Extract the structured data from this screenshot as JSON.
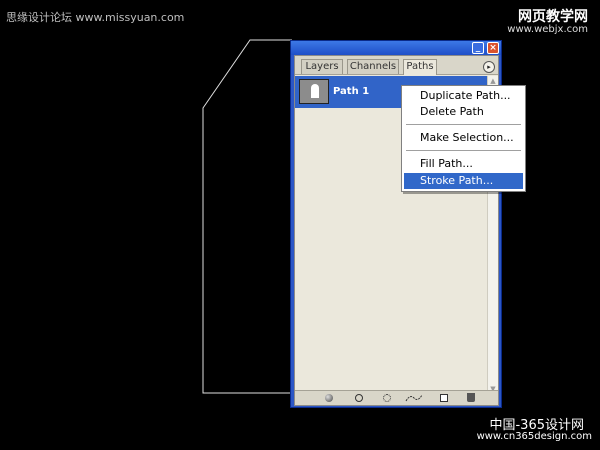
{
  "watermarks": {
    "top_left": "思缘设计论坛 www.missyuan.com",
    "top_right_main": "网页教学网",
    "top_right_url": "www.webjx.com",
    "bottom_right_main": "中国-365设计网",
    "bottom_right_url": "www.cn365design.com"
  },
  "palette": {
    "tabs": [
      "Layers",
      "Channels",
      "Paths"
    ],
    "active_tab": "Paths",
    "minimize_glyph": "_",
    "close_glyph": "×",
    "menu_glyph": "▸",
    "paths": [
      {
        "name": "Path 1",
        "selected": true
      }
    ],
    "footer_icons": [
      "fill-path-icon",
      "stroke-path-icon",
      "load-selection-icon",
      "make-work-path-icon",
      "new-path-icon",
      "delete-path-icon"
    ]
  },
  "context_menu": {
    "items": [
      "Duplicate Path...",
      "Delete Path",
      "Make Selection...",
      "Fill Path...",
      "Stroke Path..."
    ],
    "selected": "Stroke Path..."
  },
  "colors": {
    "background": "#000000",
    "palette_frame": "#2b56c6",
    "selection_blue": "#3168c9",
    "panel_bg": "#ebe8dc"
  }
}
